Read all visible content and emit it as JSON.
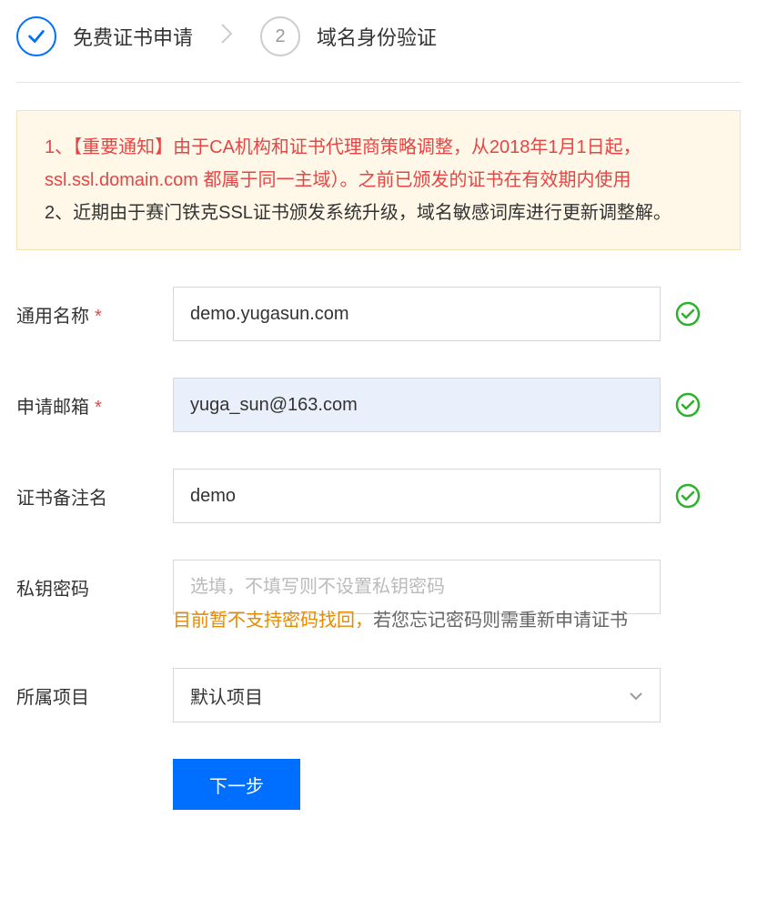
{
  "steps": {
    "step1": "免费证书申请",
    "step2_num": "2",
    "step2": "域名身份验证"
  },
  "notice": {
    "line1": "1、【重要通知】由于CA机构和证书代理商策略调整，从2018年1月1日起，ssl.ssl.domain.com 都属于同一主域）。之前已颁发的证书在有效期内使用",
    "line2": "2、近期由于赛门铁克SSL证书颁发系统升级，域名敏感词库进行更新调整解。"
  },
  "form": {
    "commonName": {
      "label": "通用名称",
      "value": "demo.yugasun.com"
    },
    "email": {
      "label": "申请邮箱",
      "value": "yuga_sun@163.com"
    },
    "remark": {
      "label": "证书备注名",
      "value": "demo"
    },
    "keyPass": {
      "label": "私钥密码",
      "placeholder": "选填，不填写则不设置私钥密码"
    },
    "keyPassHint1": "目前暂不支持密码找回，",
    "keyPassHint2": "若您忘记密码则需重新申请证书",
    "project": {
      "label": "所属项目",
      "value": "默认项目"
    },
    "submit": "下一步"
  }
}
